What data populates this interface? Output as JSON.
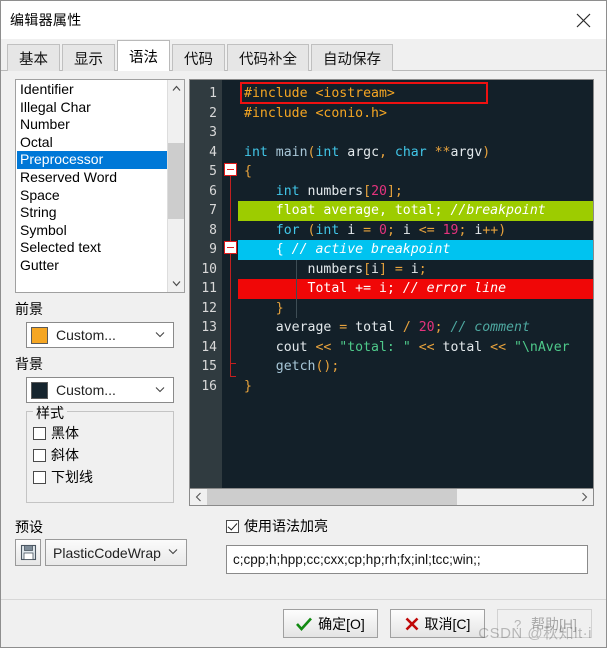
{
  "window": {
    "title": "编辑器属性",
    "close_label": "×"
  },
  "tabs": [
    {
      "label": "基本",
      "active": false
    },
    {
      "label": "显示",
      "active": false
    },
    {
      "label": "语法",
      "active": true
    },
    {
      "label": "代码",
      "active": false
    },
    {
      "label": "代码补全",
      "active": false
    },
    {
      "label": "自动保存",
      "active": false
    }
  ],
  "element_list": {
    "items": [
      "Identifier",
      "Illegal Char",
      "Number",
      "Octal",
      "Preprocessor",
      "Reserved Word",
      "Space",
      "String",
      "Symbol",
      "Selected text",
      "Gutter"
    ],
    "selected": "Preprocessor",
    "selected_index": 4,
    "scroll_up": "▲",
    "scroll_down": "▼"
  },
  "foreground": {
    "label": "前景",
    "value": "Custom...",
    "color": "#f5a623",
    "arrow": "˅"
  },
  "background": {
    "label": "背景",
    "value": "Custom...",
    "color": "#16252e",
    "arrow": "˅"
  },
  "style_group": {
    "title": "样式",
    "options": [
      {
        "label": "黑体",
        "checked": false
      },
      {
        "label": "斜体",
        "checked": false
      },
      {
        "label": "下划线",
        "checked": false
      }
    ]
  },
  "preset": {
    "label": "预设",
    "value": "PlasticCodeWrap",
    "arrow": "˅",
    "save_icon": "disk-icon"
  },
  "syntax_highlight": {
    "label": "使用语法加亮",
    "checked": true
  },
  "extensions": {
    "value": "c;cpp;h;hpp;cc;cxx;cp;hp;rh;fx;inl;tcc;win;;",
    "placeholder": "c;cpp;h"
  },
  "editor": {
    "line_numbers": [
      "1",
      "2",
      "3",
      "4",
      "5",
      "6",
      "7",
      "8",
      "9",
      "10",
      "11",
      "12",
      "13",
      "14",
      "15",
      "16"
    ],
    "highlight_box_line": 1,
    "lines": [
      {
        "n": 1,
        "state": "normal",
        "tokens": [
          {
            "t": "#include ",
            "c": "t-pre"
          },
          {
            "t": "<iostream>",
            "c": "t-pre"
          }
        ]
      },
      {
        "n": 2,
        "state": "normal",
        "tokens": [
          {
            "t": "#include ",
            "c": "t-pre"
          },
          {
            "t": "<conio.h>",
            "c": "t-pre"
          }
        ]
      },
      {
        "n": 3,
        "state": "normal",
        "tokens": []
      },
      {
        "n": 4,
        "state": "normal",
        "tokens": [
          {
            "t": "int ",
            "c": "t-kw"
          },
          {
            "t": "main",
            "c": "t-fn"
          },
          {
            "t": "(",
            "c": "t-punc"
          },
          {
            "t": "int ",
            "c": "t-kw"
          },
          {
            "t": "argc",
            "c": "t-id"
          },
          {
            "t": ", ",
            "c": "t-punc"
          },
          {
            "t": "char ",
            "c": "t-kw"
          },
          {
            "t": "**",
            "c": "t-op"
          },
          {
            "t": "argv",
            "c": "t-id"
          },
          {
            "t": ")",
            "c": "t-punc"
          }
        ]
      },
      {
        "n": 5,
        "state": "normal",
        "tokens": [
          {
            "t": "{",
            "c": "t-punc"
          }
        ]
      },
      {
        "n": 6,
        "state": "normal",
        "tokens": [
          {
            "t": "    int ",
            "c": "t-kw"
          },
          {
            "t": "numbers",
            "c": "t-id"
          },
          {
            "t": "[",
            "c": "t-brk"
          },
          {
            "t": "20",
            "c": "t-num"
          },
          {
            "t": "]",
            "c": "t-brk"
          },
          {
            "t": ";",
            "c": "t-punc"
          }
        ]
      },
      {
        "n": 7,
        "state": "bp",
        "tokens": [
          {
            "t": "    float ",
            "c": "t-kw"
          },
          {
            "t": "average, total",
            "c": "t-id"
          },
          {
            "t": "; ",
            "c": "t-punc"
          },
          {
            "t": "//breakpoint",
            "c": "t-cmt"
          }
        ]
      },
      {
        "n": 8,
        "state": "normal",
        "tokens": [
          {
            "t": "    for ",
            "c": "t-kw"
          },
          {
            "t": "(",
            "c": "t-punc"
          },
          {
            "t": "int ",
            "c": "t-kw"
          },
          {
            "t": "i ",
            "c": "t-id"
          },
          {
            "t": "= ",
            "c": "t-op"
          },
          {
            "t": "0",
            "c": "t-num"
          },
          {
            "t": "; ",
            "c": "t-punc"
          },
          {
            "t": "i ",
            "c": "t-id"
          },
          {
            "t": "<= ",
            "c": "t-op"
          },
          {
            "t": "19",
            "c": "t-num"
          },
          {
            "t": "; ",
            "c": "t-punc"
          },
          {
            "t": "i",
            "c": "t-id"
          },
          {
            "t": "++",
            "c": "t-op"
          },
          {
            "t": ")",
            "c": "t-punc"
          }
        ]
      },
      {
        "n": 9,
        "state": "act",
        "tokens": [
          {
            "t": "    { ",
            "c": "t-punc"
          },
          {
            "t": "// active breakpoint",
            "c": "t-cmt"
          }
        ]
      },
      {
        "n": 10,
        "state": "normal",
        "tokens": [
          {
            "t": "        numbers",
            "c": "t-id"
          },
          {
            "t": "[",
            "c": "t-brk"
          },
          {
            "t": "i",
            "c": "t-id"
          },
          {
            "t": "]",
            "c": "t-brk"
          },
          {
            "t": " = ",
            "c": "t-op"
          },
          {
            "t": "i",
            "c": "t-id"
          },
          {
            "t": ";",
            "c": "t-punc"
          }
        ]
      },
      {
        "n": 11,
        "state": "err",
        "tokens": [
          {
            "t": "        Total ",
            "c": "t-id"
          },
          {
            "t": "+= ",
            "c": "t-op"
          },
          {
            "t": "i",
            "c": "t-id"
          },
          {
            "t": "; ",
            "c": "t-punc"
          },
          {
            "t": "// error line",
            "c": "t-cmt"
          }
        ]
      },
      {
        "n": 12,
        "state": "normal",
        "tokens": [
          {
            "t": "    }",
            "c": "t-punc"
          }
        ]
      },
      {
        "n": 13,
        "state": "normal",
        "tokens": [
          {
            "t": "    average ",
            "c": "t-id"
          },
          {
            "t": "= ",
            "c": "t-op"
          },
          {
            "t": "total ",
            "c": "t-id"
          },
          {
            "t": "/ ",
            "c": "t-op"
          },
          {
            "t": "20",
            "c": "t-num"
          },
          {
            "t": "; ",
            "c": "t-punc"
          },
          {
            "t": "// comment",
            "c": "t-cmt"
          }
        ]
      },
      {
        "n": 14,
        "state": "normal",
        "tokens": [
          {
            "t": "    cout ",
            "c": "t-id"
          },
          {
            "t": "<< ",
            "c": "t-op"
          },
          {
            "t": "\"total: \"",
            "c": "t-str"
          },
          {
            "t": " << ",
            "c": "t-op"
          },
          {
            "t": "total ",
            "c": "t-id"
          },
          {
            "t": "<< ",
            "c": "t-op"
          },
          {
            "t": "\"\\nAver",
            "c": "t-str"
          }
        ]
      },
      {
        "n": 15,
        "state": "normal",
        "tokens": [
          {
            "t": "    getch",
            "c": "t-fn"
          },
          {
            "t": "()",
            "c": "t-punc"
          },
          {
            "t": ";",
            "c": "t-punc"
          }
        ]
      },
      {
        "n": 16,
        "state": "normal",
        "tokens": [
          {
            "t": "}",
            "c": "t-punc"
          }
        ]
      }
    ],
    "hscroll": {
      "left_arrow": "‹",
      "right_arrow": "›"
    }
  },
  "footer": {
    "ok": "确定[O]",
    "cancel": "取消[C]",
    "help": "帮助[H]",
    "help_disabled": true
  },
  "watermark": "CSDN @秋知lt·i"
}
